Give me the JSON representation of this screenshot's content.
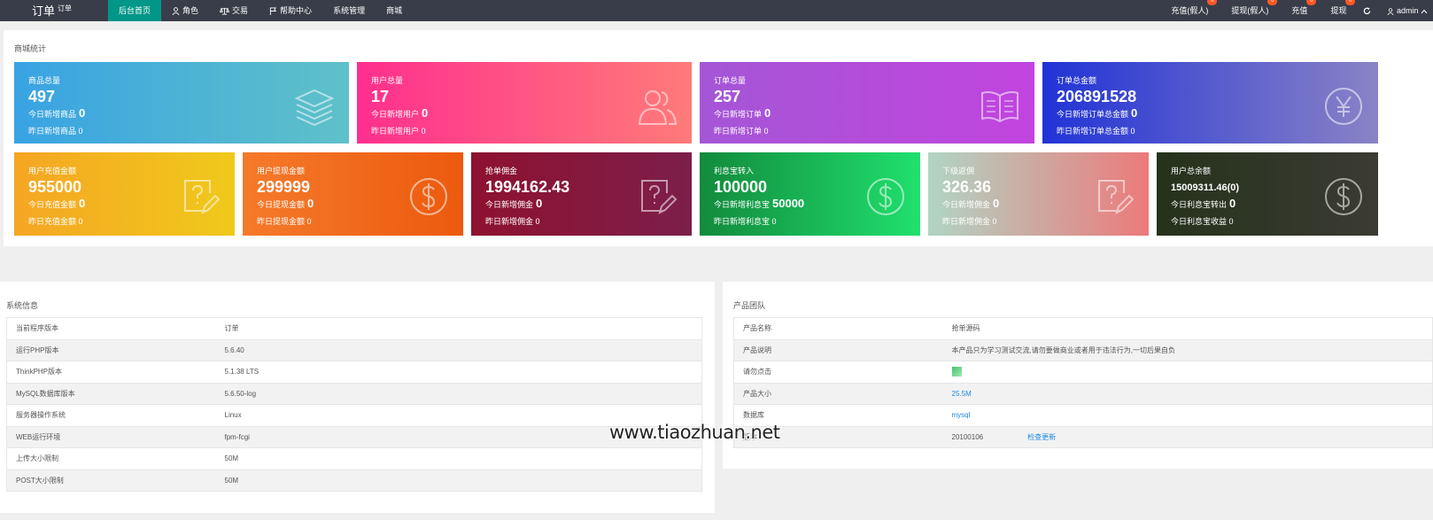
{
  "header": {
    "logo": "订单",
    "logo_sup": "订单",
    "nav": [
      {
        "label": "后台首页",
        "icon": ""
      },
      {
        "label": "角色",
        "icon": "user-icon"
      },
      {
        "label": "交易",
        "icon": "scale-icon"
      },
      {
        "label": "帮助中心",
        "icon": "flag-icon"
      },
      {
        "label": "系统管理",
        "icon": ""
      },
      {
        "label": "商城",
        "icon": ""
      }
    ],
    "right": [
      {
        "label": "充值(假人)",
        "badge": "0"
      },
      {
        "label": "提现(假人)",
        "badge": "0"
      },
      {
        "label": "充值",
        "badge": "0"
      },
      {
        "label": "提现",
        "badge": "0"
      }
    ],
    "refresh_icon": "refresh-icon",
    "user": "admin"
  },
  "stats": {
    "title": "商城统计",
    "row1": [
      {
        "label": "商品总量",
        "value": "497",
        "line1": "今日新增商品",
        "val1": "0",
        "line2": "昨日新增商品 0",
        "icon": "layers-icon"
      },
      {
        "label": "用户总量",
        "value": "17",
        "line1": "今日新增用户",
        "val1": "0",
        "line2": "昨日新增用户 0",
        "icon": "users-icon"
      },
      {
        "label": "订单总量",
        "value": "257",
        "line1": "今日新增订单",
        "val1": "0",
        "line2": "昨日新增订单 0",
        "icon": "book-icon"
      },
      {
        "label": "订单总金额",
        "value": "206891528",
        "line1": "今日新增订单总金额",
        "val1": "0",
        "line2": "昨日新增订单总金额 0",
        "icon": "yen-icon"
      }
    ],
    "row2": [
      {
        "label": "用户充值金额",
        "value": "955000",
        "line1": "今日充值金额",
        "val1": "0",
        "line2": "昨日充值金额 0",
        "icon": "edit-doc-icon"
      },
      {
        "label": "用户提现金额",
        "value": "299999",
        "line1": "今日提现金额",
        "val1": "0",
        "line2": "昨日提现金额 0",
        "icon": "dollar-icon"
      },
      {
        "label": "抢单佣金",
        "value": "1994162.43",
        "line1": "今日新增佣金",
        "val1": "0",
        "line2": "昨日新增佣金 0",
        "icon": "edit-doc-icon"
      },
      {
        "label": "利息宝转入",
        "value": "100000",
        "line1": "今日新增利息宝",
        "val1": "50000",
        "line2": "昨日新增利息宝 0",
        "icon": "dollar-icon"
      },
      {
        "label": "下级返佣",
        "value": "326.36",
        "line1": "今日新增佣金",
        "val1": "0",
        "line2": "昨日新增佣金 0",
        "icon": "edit-doc-icon"
      },
      {
        "label": "用户总余额",
        "value": "15009311.46(0)",
        "line1": "今日利息宝转出",
        "val1": "0",
        "line2": "今日利息宝收益 0",
        "icon": "dollar-icon"
      }
    ]
  },
  "sysinfo": {
    "title": "系统信息",
    "rows": [
      [
        "当前程序版本",
        "订单"
      ],
      [
        "运行PHP版本",
        "5.6.40"
      ],
      [
        "ThinkPHP版本",
        "5.1.38 LTS"
      ],
      [
        "MySQL数据库版本",
        "5.6.50-log"
      ],
      [
        "服务器操作系统",
        "Linux"
      ],
      [
        "WEB运行环境",
        "fpm-fcgi"
      ],
      [
        "上传大小限制",
        "50M"
      ],
      [
        "POST大小限制",
        "50M"
      ]
    ]
  },
  "team": {
    "title": "产品团队",
    "rows": [
      [
        "产品名称",
        "抢单源码"
      ],
      [
        "产品说明",
        "本产品只为学习测试交流,请勿要做商业或者用于违法行为,一切后果自负"
      ],
      [
        "请勿点击",
        ""
      ],
      [
        "产品大小",
        "25.5M"
      ],
      [
        "数据库",
        "mysql"
      ],
      [
        "版本",
        "20100106"
      ]
    ],
    "update_link": "检查更新"
  },
  "watermark": "www.tiaozhuan.net"
}
